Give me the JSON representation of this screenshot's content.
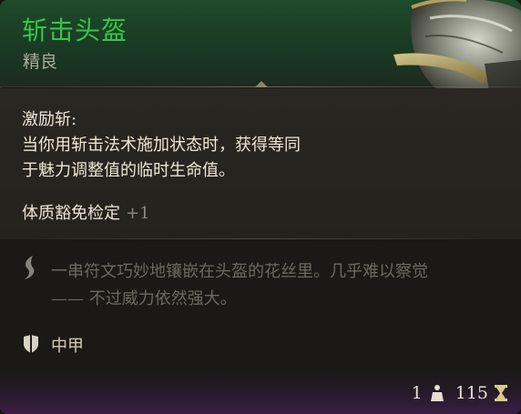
{
  "item": {
    "name": "斩击头盔",
    "rarity": "精良",
    "name_color": "#35c646"
  },
  "effect": {
    "title": "激励斩:",
    "desc_line1": "当你用斩击法术施加状态时，获得等同",
    "desc_line2": "于魅力调整值的临时生命值。",
    "bonus_label": "体质豁免检定",
    "bonus_value": "+1"
  },
  "flavor": {
    "line1": "一串符文巧妙地镶嵌在头盔的花丝里。几乎难以察觉",
    "line2": "—— 不过威力依然强大。",
    "icon": "quill-icon"
  },
  "armor": {
    "type": "中甲",
    "icon": "shield-icon"
  },
  "footer": {
    "weight": "1",
    "weight_icon": "weight-icon",
    "value": "115",
    "value_icon": "hourglass-icon"
  }
}
